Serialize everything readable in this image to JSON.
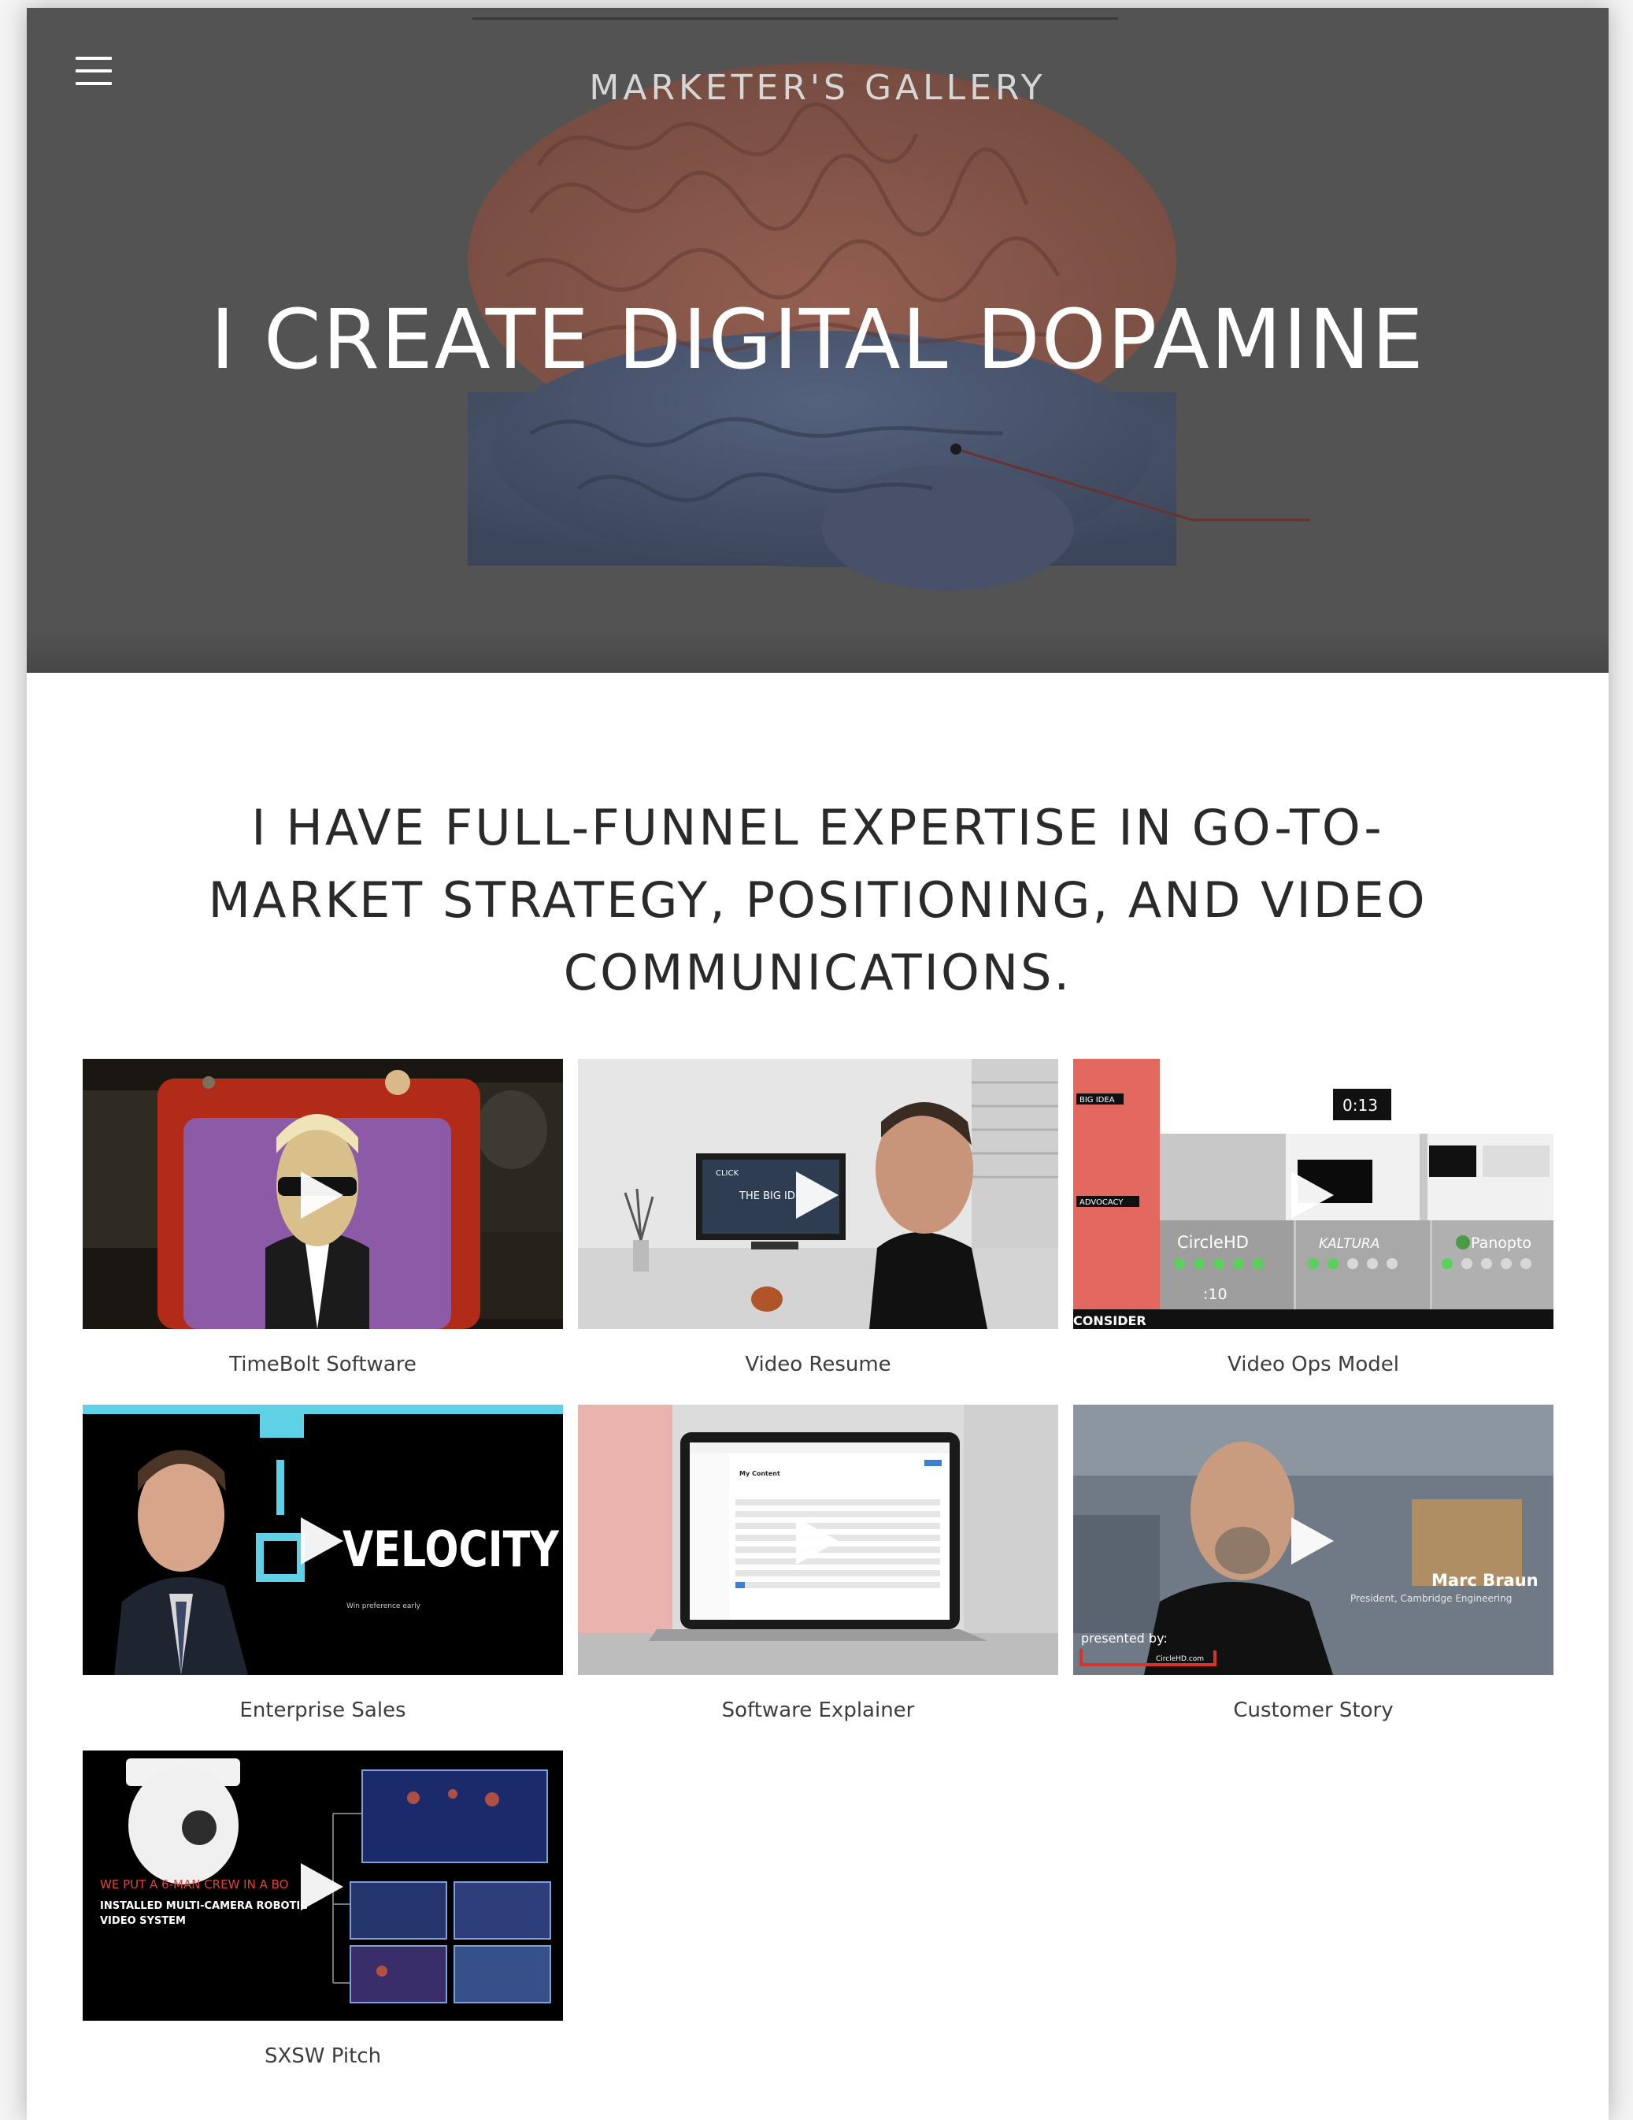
{
  "header": {
    "site_title": "MARKETER'S GALLERY",
    "menu_icon": "hamburger-menu-icon",
    "headline": "I CREATE DIGITAL DOPAMINE"
  },
  "intro": {
    "lines": [
      "I HAVE FULL-FUNNEL EXPERTISE IN GO-TO-",
      "MARKET STRATEGY, POSITIONING, AND VIDEO",
      "COMMUNICATIONS."
    ]
  },
  "gallery": {
    "items": [
      {
        "caption": "TimeBolt Software"
      },
      {
        "caption": "Video Resume"
      },
      {
        "caption": "Video Ops Model"
      },
      {
        "caption": "Enterprise Sales"
      },
      {
        "caption": "Software Explainer"
      },
      {
        "caption": "Customer Story"
      },
      {
        "caption": "SXSW Pitch"
      }
    ],
    "thumb_text": {
      "video_resume_screen": "THE BIG ID",
      "video_resume_click": "CLICK",
      "ops_timer": "0:13",
      "ops_big_idea": "BIG IDEA",
      "ops_advocacy": "ADVOCACY",
      "ops_consider": "CONSIDER",
      "ops_circlehd": "CircleHD",
      "ops_kaltura": "KALTURA",
      "ops_panopto": "Panopto",
      "ops_ten": ":10",
      "velocity": "VELOCITY",
      "velocity_sub": "Win preference early",
      "explainer_title": "My Content",
      "customer_name": "Marc Braun",
      "customer_role": "President, Cambridge Engineering",
      "customer_presented": "presented by:",
      "customer_site": "CircleHD.com",
      "sxsw_red": "WE PUT A 6-MAN CREW IN A BO",
      "sxsw_white_1": "INSTALLED MULTI-CAMERA ROBOTIC",
      "sxsw_white_2": "VIDEO SYSTEM"
    }
  },
  "colors": {
    "hero_bg": "#5b5b5b",
    "caption_text": "#3d3d3d",
    "intro_text": "#2a2a2a"
  }
}
